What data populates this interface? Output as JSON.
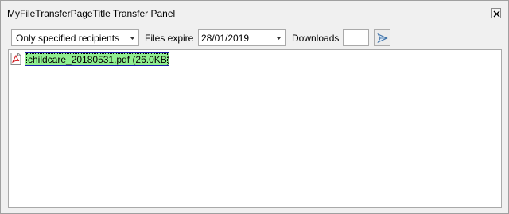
{
  "window": {
    "title": "MyFileTransferPageTitle Transfer Panel",
    "close_icon": "close-icon"
  },
  "toolbar": {
    "recipients_select": {
      "value": "Only specified recipients",
      "icon": "chevron-down-icon"
    },
    "files_expire_label": "Files expire",
    "expire_date_select": {
      "value": "28/01/2019",
      "icon": "chevron-down-icon"
    },
    "downloads_label": "Downloads",
    "downloads_value": "",
    "send_icon": "send-icon"
  },
  "files": [
    {
      "label": "childcare_20180531.pdf (26.0KB)",
      "icon": "pdf-file-icon",
      "selected": true,
      "highlight": "#90ee90"
    }
  ]
}
